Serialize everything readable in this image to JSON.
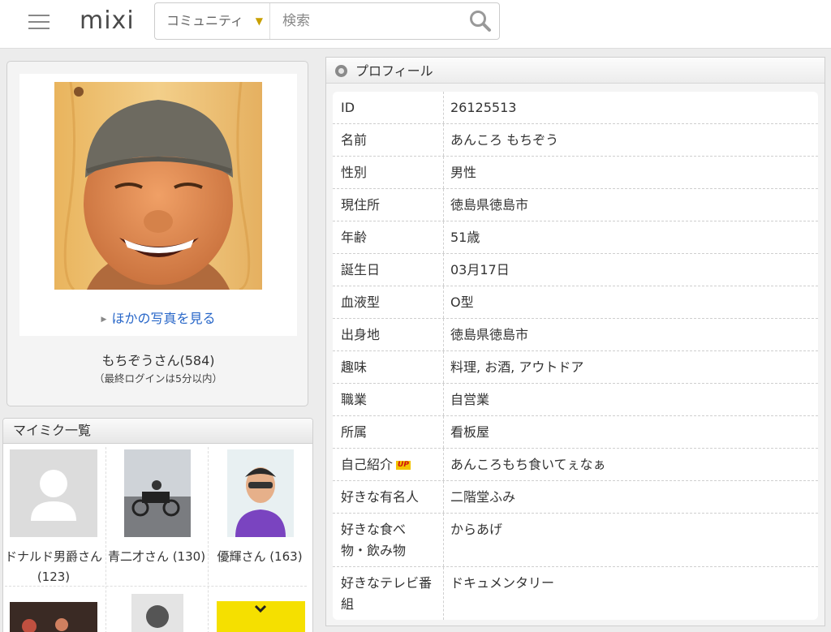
{
  "header": {
    "logo": "mixi",
    "search_scope": "コミュニティ",
    "search_placeholder": "検索"
  },
  "profile_photo": {
    "other_photos_link": "ほかの写真を見る",
    "user_name": "もちぞうさん(584)",
    "last_login": "（最終ログインは5分以内）"
  },
  "mymixi": {
    "title": "マイミク一覧",
    "friends": [
      {
        "name": "ドナルド男爵さん (123)"
      },
      {
        "name": "青二才さん (130)"
      },
      {
        "name": "優輝さん (163)"
      }
    ]
  },
  "profile": {
    "title": "プロフィール",
    "up_badge": "UP",
    "rows": [
      {
        "label": "ID",
        "value": "26125513"
      },
      {
        "label": "名前",
        "value": "あんころ もちぞう"
      },
      {
        "label": "性別",
        "value": "男性"
      },
      {
        "label": "現住所",
        "value": "徳島県徳島市"
      },
      {
        "label": "年齢",
        "value": "51歳"
      },
      {
        "label": "誕生日",
        "value": "03月17日"
      },
      {
        "label": "血液型",
        "value": "O型"
      },
      {
        "label": "出身地",
        "value": "徳島県徳島市"
      },
      {
        "label": "趣味",
        "value": "料理, お酒, アウトドア"
      },
      {
        "label": "職業",
        "value": "自営業"
      },
      {
        "label": "所属",
        "value": "看板屋"
      },
      {
        "label": "自己紹介",
        "value": "あんころもち食いてぇなぁ"
      },
      {
        "label": "好きな有名人",
        "value": "二階堂ふみ"
      },
      {
        "label": "好きな食べ物・飲み物",
        "value": "からあげ"
      },
      {
        "label": "好きなテレビ番組",
        "value": "ドキュメンタリー"
      }
    ]
  }
}
